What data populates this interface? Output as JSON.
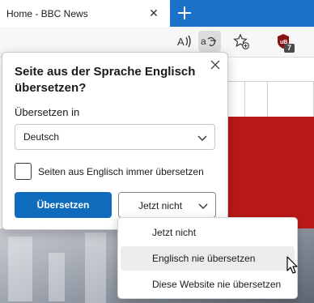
{
  "tab": {
    "title": "Home - BBC News",
    "close_glyph": "✕"
  },
  "toolbar": {
    "icons": [
      "read-aloud-icon",
      "translate-icon",
      "add-favorite-icon",
      "extension-icon"
    ],
    "extension_badge": "7"
  },
  "popup": {
    "title": "Seite aus der Sprache Englisch übersetzen?",
    "target_label": "Übersetzen in",
    "target_value": "Deutsch",
    "always_translate_label": "Seiten aus Englisch immer übersetzen",
    "always_translate_checked": false,
    "translate_button": "Übersetzen",
    "not_now_button": "Jetzt nicht"
  },
  "menu": {
    "items": [
      {
        "label": "Jetzt nicht"
      },
      {
        "label": "Englisch nie übersetzen"
      },
      {
        "label": "Diese Website nie übersetzen"
      }
    ],
    "hovered_item": "Englisch nie übersetzen"
  },
  "colors": {
    "tabstrip": "#1a73c9",
    "primary_button": "#0f6cbd",
    "bbc_red": "#bb1919"
  }
}
